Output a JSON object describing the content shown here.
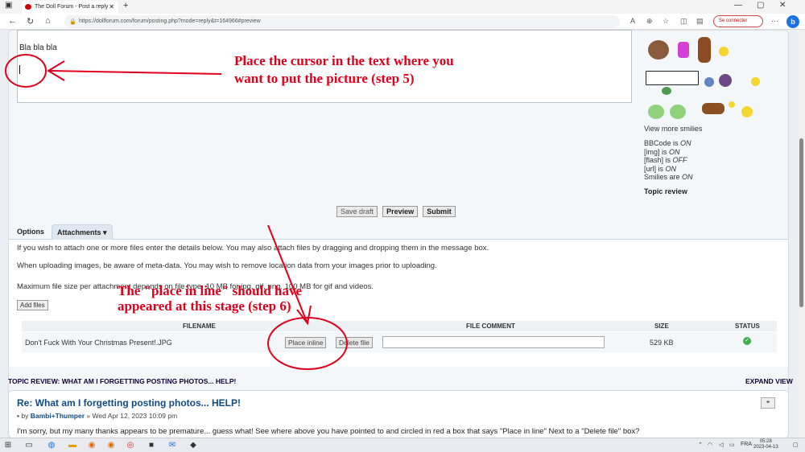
{
  "browser": {
    "tab_title": "The Doll Forum - Post a reply",
    "url": "https://dollforum.com/forum/posting.php?mode=reply&t=164966#preview",
    "signin": "Se connecter"
  },
  "editor": {
    "text": "Bla bla bla"
  },
  "annotations": {
    "step5_line1": "Place the cursor in the text where you",
    "step5_line2": "want to put the picture (step 5)",
    "step6_line1": "The \"place in line\" should have",
    "step6_line2": "appeared at this stage (step 6)"
  },
  "sidebar": {
    "view_more": "View more smilies",
    "bbcode": [
      "BBCode is ",
      "ON"
    ],
    "img": [
      "[img] is ",
      "ON"
    ],
    "flash": [
      "[flash] is ",
      "OFF"
    ],
    "urlbb": [
      "[url] is ",
      "ON"
    ],
    "smilies": [
      "Smilies are ",
      "ON"
    ],
    "topic_review": "Topic review"
  },
  "actions": {
    "save_draft": "Save draft",
    "preview": "Preview",
    "submit": "Submit"
  },
  "tabs": {
    "options": "Options",
    "attachments": "Attachments"
  },
  "attach": {
    "p1": "If you wish to attach one or more files enter the details below. You may also attach files by dragging and dropping them in the message box.",
    "p2": "When uploading images, be aware of meta-data. You may wish to remove location data from your images prior to uploading.",
    "p3": "Maximum file size per attachment depends on file type. 10 MB for jpg, gif, png. 100 MB for gif and videos.",
    "add_files": "Add files",
    "col_filename": "FILENAME",
    "col_comment": "FILE COMMENT",
    "col_size": "SIZE",
    "col_status": "STATUS",
    "file": {
      "name": "Don't Fuck With Your Christmas Present!.JPG",
      "place_inline": "Place inline",
      "delete_file": "Delete file",
      "size": "529 KB",
      "status_icon": "check-icon"
    }
  },
  "review": {
    "header": "TOPIC REVIEW: WHAT AM I FORGETTING POSTING PHOTOS... HELP!",
    "expand": "EXPAND VIEW",
    "post_title": "Re: What am I forgetting posting photos... HELP!",
    "by": "by ",
    "author": "Bambi+Thumper",
    "date": " » Wed Apr 12, 2023 10:09 pm",
    "body": "I'm sorry, but my many thanks appears to be premature... guess what! See where above you have pointed to and circled in red a box that says \"Place in line\" Next to a \"Delete file\" box?"
  },
  "taskbar": {
    "lang": "FRA",
    "time": "05:28",
    "date": "2023-04-13"
  },
  "colors": {
    "annotation": "#e0001b",
    "link": "#104a80",
    "status_ok": "#3cb24a"
  }
}
